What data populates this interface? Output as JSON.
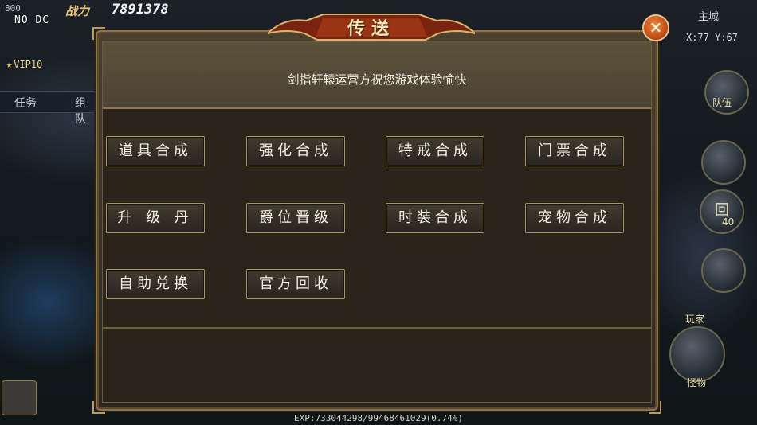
{
  "hud": {
    "no_dc": "NO DC",
    "top_number": "800",
    "power_label": "战力",
    "power_value": "7891378",
    "vip_label": "VIP10",
    "tab_task": "任务",
    "tab_group": "组队",
    "zone": "主城",
    "coords": "X:77 Y:67",
    "team_label": "队伍",
    "return_label": "回",
    "return_count": "40",
    "play_label": "玩家",
    "monster_label": "怪物",
    "exp": "EXP:733044298/99468461029(0.74%)"
  },
  "dialog": {
    "title": "传送",
    "close_label": "×",
    "banner": "剑指轩辕运营方祝您游戏体验愉快",
    "buttons": [
      {
        "label": "道具合成"
      },
      {
        "label": "强化合成"
      },
      {
        "label": "特戒合成"
      },
      {
        "label": "门票合成"
      },
      {
        "label": "升 级 丹"
      },
      {
        "label": "爵位晋级"
      },
      {
        "label": "时装合成"
      },
      {
        "label": "宠物合成"
      },
      {
        "label": "自助兑换"
      },
      {
        "label": "官方回收"
      }
    ]
  }
}
